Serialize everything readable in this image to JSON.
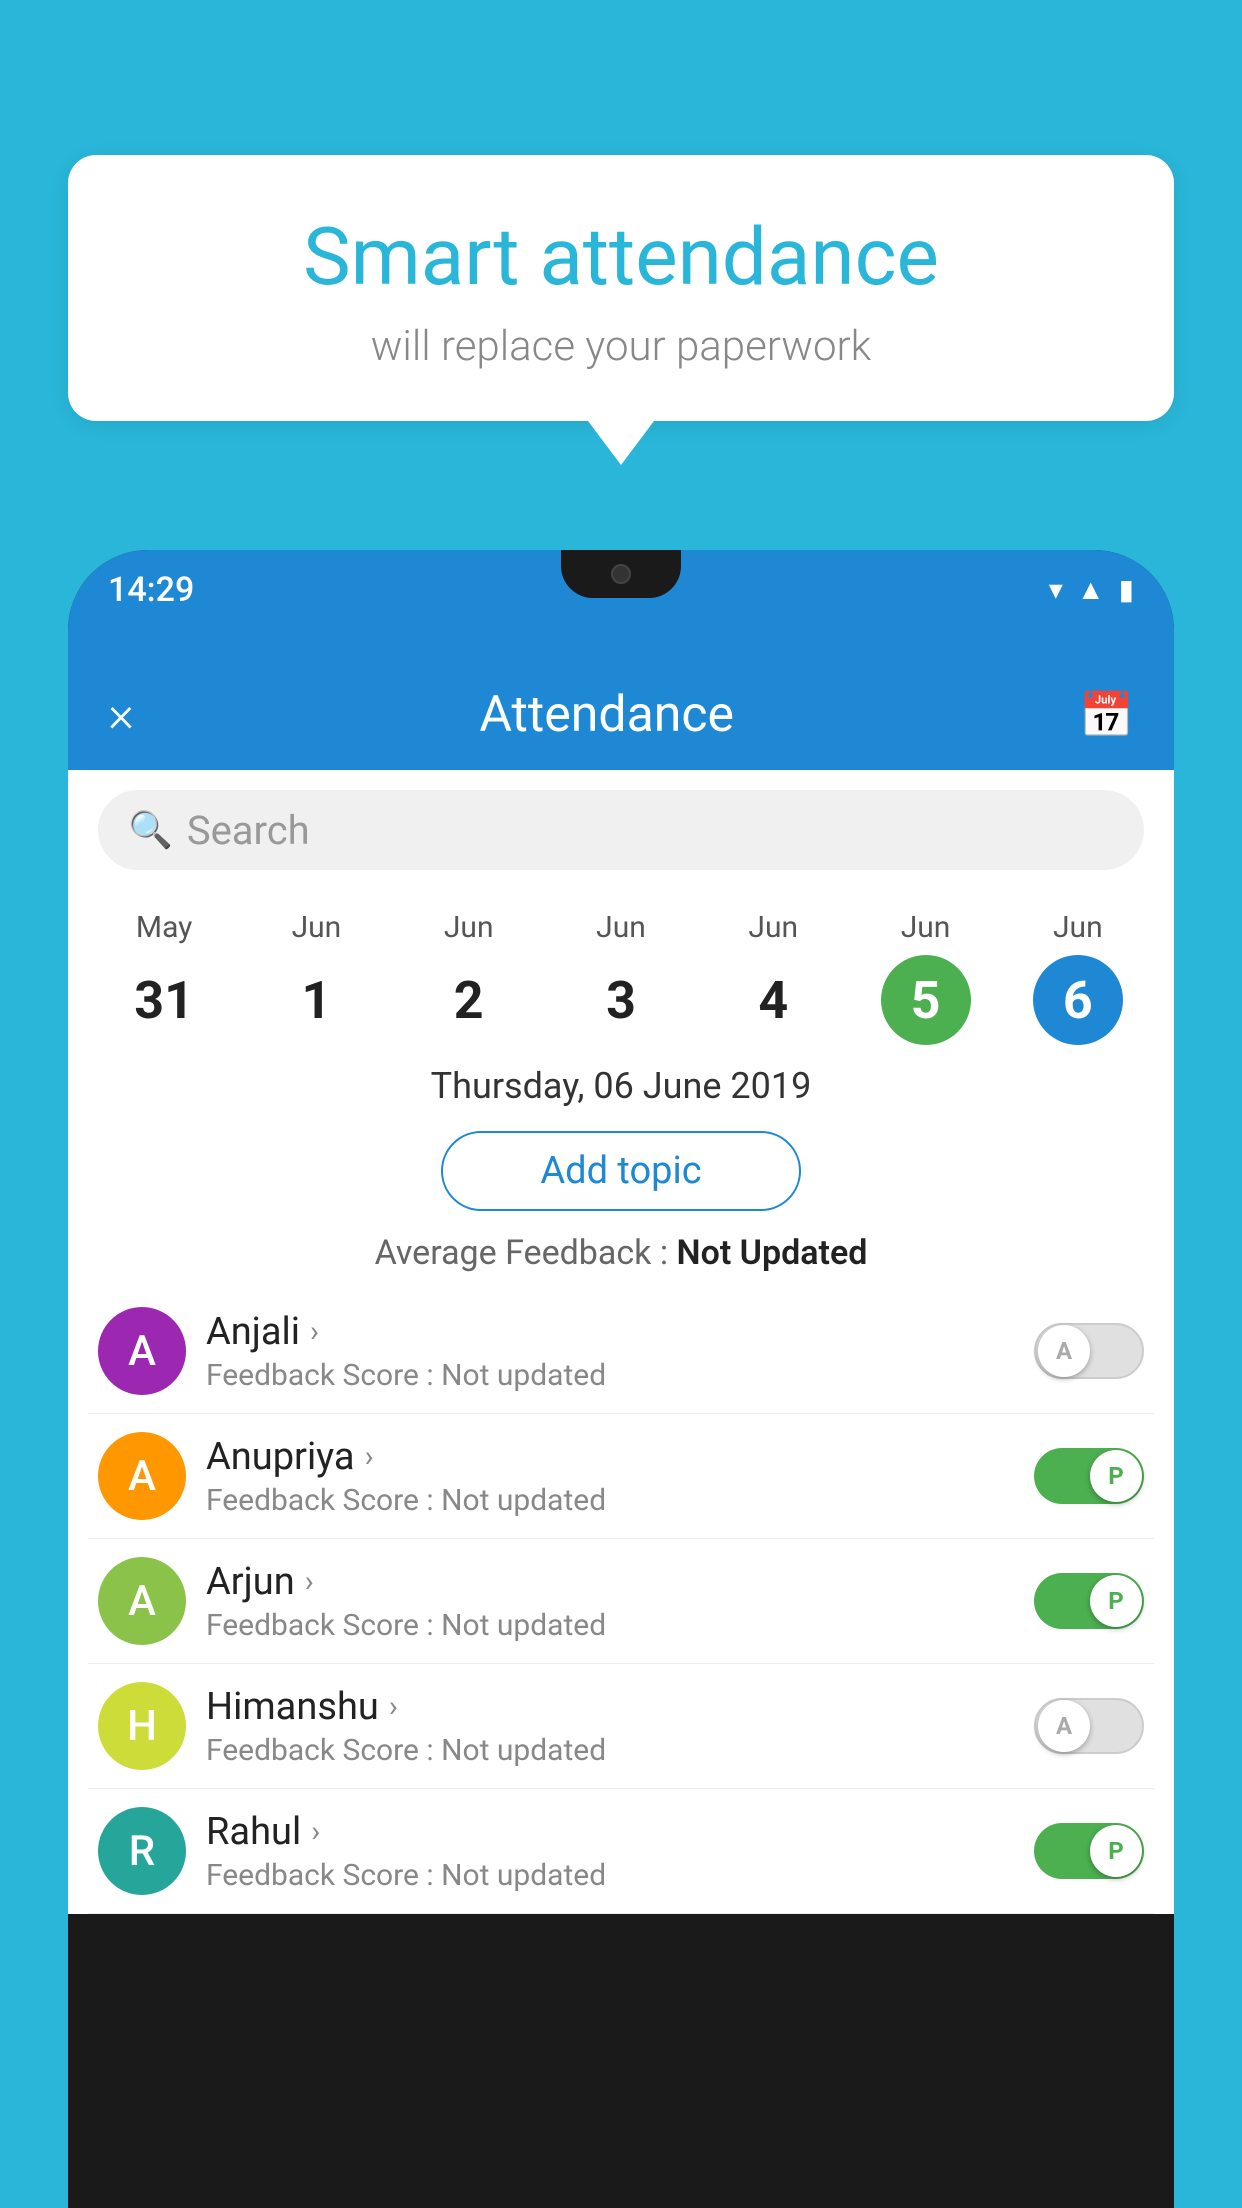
{
  "background_color": "#29B6D8",
  "bubble": {
    "title": "Smart attendance",
    "subtitle": "will replace your paperwork"
  },
  "phone": {
    "time": "14:29",
    "header": {
      "title": "Attendance",
      "close_label": "×",
      "calendar_icon": "calendar"
    },
    "search": {
      "placeholder": "Search"
    },
    "calendar": {
      "days": [
        {
          "month": "May",
          "num": "31",
          "state": "normal"
        },
        {
          "month": "Jun",
          "num": "1",
          "state": "normal"
        },
        {
          "month": "Jun",
          "num": "2",
          "state": "normal"
        },
        {
          "month": "Jun",
          "num": "3",
          "state": "normal"
        },
        {
          "month": "Jun",
          "num": "4",
          "state": "normal"
        },
        {
          "month": "Jun",
          "num": "5",
          "state": "green"
        },
        {
          "month": "Jun",
          "num": "6",
          "state": "blue"
        }
      ]
    },
    "selected_date": "Thursday, 06 June 2019",
    "add_topic_label": "Add topic",
    "avg_feedback_label": "Average Feedback :",
    "avg_feedback_value": "Not Updated",
    "students": [
      {
        "name": "Anjali",
        "avatar_letter": "A",
        "avatar_color": "purple",
        "feedback": "Feedback Score : Not updated",
        "toggle_state": "off",
        "toggle_letter": "A"
      },
      {
        "name": "Anupriya",
        "avatar_letter": "A",
        "avatar_color": "orange",
        "feedback": "Feedback Score : Not updated",
        "toggle_state": "on",
        "toggle_letter": "P"
      },
      {
        "name": "Arjun",
        "avatar_letter": "A",
        "avatar_color": "green",
        "feedback": "Feedback Score : Not updated",
        "toggle_state": "on",
        "toggle_letter": "P"
      },
      {
        "name": "Himanshu",
        "avatar_letter": "H",
        "avatar_color": "lime",
        "feedback": "Feedback Score : Not updated",
        "toggle_state": "off",
        "toggle_letter": "A"
      },
      {
        "name": "Rahul",
        "avatar_letter": "R",
        "avatar_color": "teal",
        "feedback": "Feedback Score : Not updated",
        "toggle_state": "on",
        "toggle_letter": "P"
      }
    ]
  }
}
